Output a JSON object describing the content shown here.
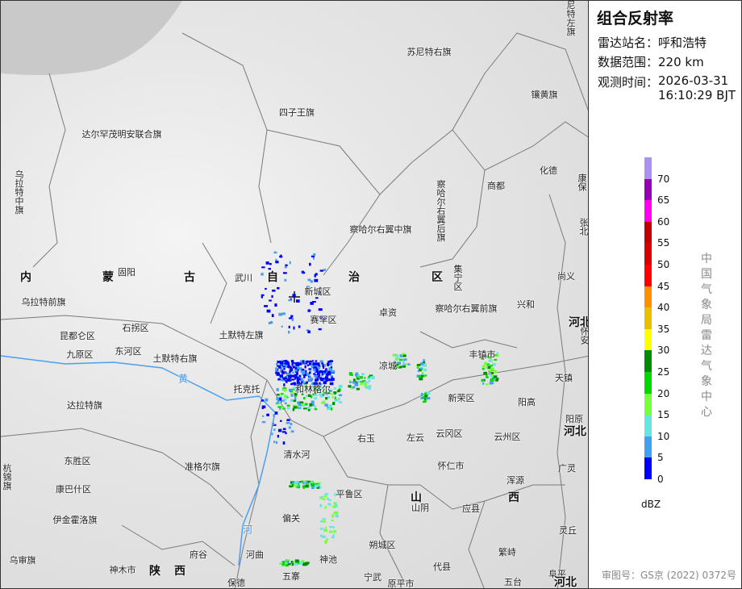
{
  "panel": {
    "title": "组合反射率",
    "station_label": "雷达站名：",
    "station": "呼和浩特",
    "range_label": "数据范围：",
    "range": "220 km",
    "time_label": "观测时间：",
    "date": "2026-03-31",
    "time": "16:10:29 BJT",
    "organization": "中国气象局雷达气象中心",
    "unit": "dBZ",
    "approval": "审图号：GS京 (2022) 0372号"
  },
  "legend": {
    "ticks": [
      "70",
      "65",
      "60",
      "55",
      "50",
      "45",
      "40",
      "35",
      "30",
      "25",
      "20",
      "15",
      "10",
      "5",
      "0"
    ],
    "colors": [
      "#ad90f0",
      "#9600b4",
      "#ff00f0",
      "#c00000",
      "#d60000",
      "#ff0000",
      "#ff9000",
      "#e7c000",
      "#ffff00",
      "#008c00",
      "#00d800",
      "#76ff3c",
      "#66e5e5",
      "#42a0f0",
      "#0000f6"
    ]
  },
  "map": {
    "labels": [
      "苏尼特左旗",
      "苏尼特右旗",
      "镶黄旗",
      "四子王旗",
      "达尔罕茂明安联合旗",
      "乌拉特中旗",
      "察哈尔右翼后旗",
      "商都",
      "化德",
      "康保",
      "察哈尔右翼中旗",
      "张北",
      "固阳",
      "武川",
      "新城区",
      "集宁区",
      "尚义",
      "乌拉特前旗",
      "卓资",
      "察哈尔右翼前旗",
      "兴和",
      "赛罕区",
      "石拐区",
      "昆都仑区",
      "土默特左旗",
      "怀安",
      "九原区",
      "东河区",
      "土默特右旗",
      "丰镇市",
      "凉城",
      "天镇",
      "托克托",
      "和林格尔",
      "新荣区",
      "阳高",
      "达拉特旗",
      "阳原",
      "右玉",
      "左云",
      "云冈区",
      "云州区",
      "清水河",
      "东胜区",
      "准格尔旗",
      "怀仁市",
      "广灵",
      "杭锦旗",
      "康巴什区",
      "浑源",
      "平鲁区",
      "山阴",
      "应县",
      "伊金霍洛旗",
      "偏关",
      "灵丘",
      "府谷",
      "河曲",
      "神池",
      "朔城区",
      "繁峙",
      "乌审旗",
      "神木市",
      "代县",
      "阜平",
      "保德",
      "五寨",
      "宁武",
      "原平市",
      "五台"
    ],
    "provinces": [
      "内",
      "蒙",
      "古",
      "自",
      "治",
      "区",
      "河北",
      "河北",
      "山",
      "西",
      "陕",
      "西",
      "河北"
    ],
    "rivers": [
      "黄",
      "河"
    ]
  }
}
